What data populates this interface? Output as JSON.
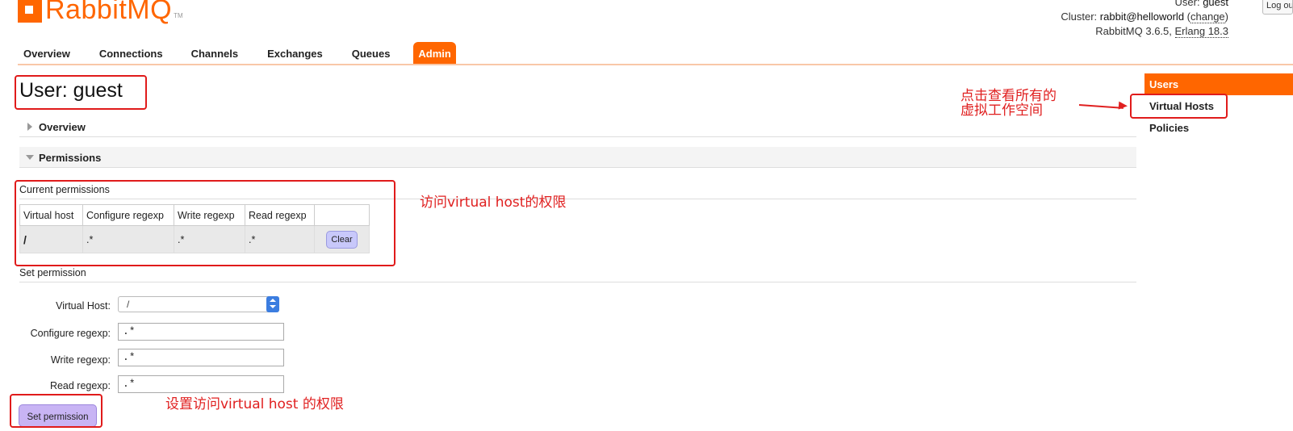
{
  "brand": {
    "name_prefix": "Rabbit",
    "name_suffix": "MQ",
    "tm": "TM"
  },
  "header": {
    "user_label": "User:",
    "user_value": "guest",
    "cluster_label": "Cluster:",
    "cluster_value": "rabbit@helloworld",
    "change_link": "change",
    "version_text": "RabbitMQ 3.6.5,",
    "erlang_text": "Erlang 18.3",
    "logout_label": "Log out"
  },
  "nav": {
    "items": [
      {
        "label": "Overview"
      },
      {
        "label": "Connections"
      },
      {
        "label": "Channels"
      },
      {
        "label": "Exchanges"
      },
      {
        "label": "Queues"
      },
      {
        "label": "Admin"
      }
    ],
    "active": "Admin"
  },
  "sidebar": {
    "items": [
      {
        "label": "Users"
      },
      {
        "label": "Virtual Hosts"
      },
      {
        "label": "Policies"
      }
    ],
    "active": "Users"
  },
  "main": {
    "page_title": "User: guest",
    "sections": {
      "overview": "Overview",
      "permissions": "Permissions"
    },
    "current_permissions": {
      "heading": "Current permissions",
      "columns": [
        "Virtual host",
        "Configure regexp",
        "Write regexp",
        "Read regexp"
      ],
      "rows": [
        {
          "vhost": "/",
          "configure": ".*",
          "write": ".*",
          "read": ".*",
          "action": "Clear"
        }
      ]
    },
    "set_permission": {
      "heading": "Set permission",
      "virtual_host_label": "Virtual Host:",
      "virtual_host_value": "/",
      "configure_label": "Configure regexp:",
      "configure_value": ".*",
      "write_label": "Write regexp:",
      "write_value": ".*",
      "read_label": "Read regexp:",
      "read_value": ".*",
      "submit_label": "Set permission"
    }
  },
  "annotations": {
    "vhosts_note_line1": "点击查看所有的",
    "vhosts_note_line2": "虚拟工作空间",
    "current_note": "访问virtual host的权限",
    "set_note": "设置访问virtual host 的权限",
    "color": "#e02020"
  },
  "colors": {
    "accent": "#ff6600",
    "button_blue": "#c8c8fa",
    "button_purple": "#c8b4f4"
  }
}
